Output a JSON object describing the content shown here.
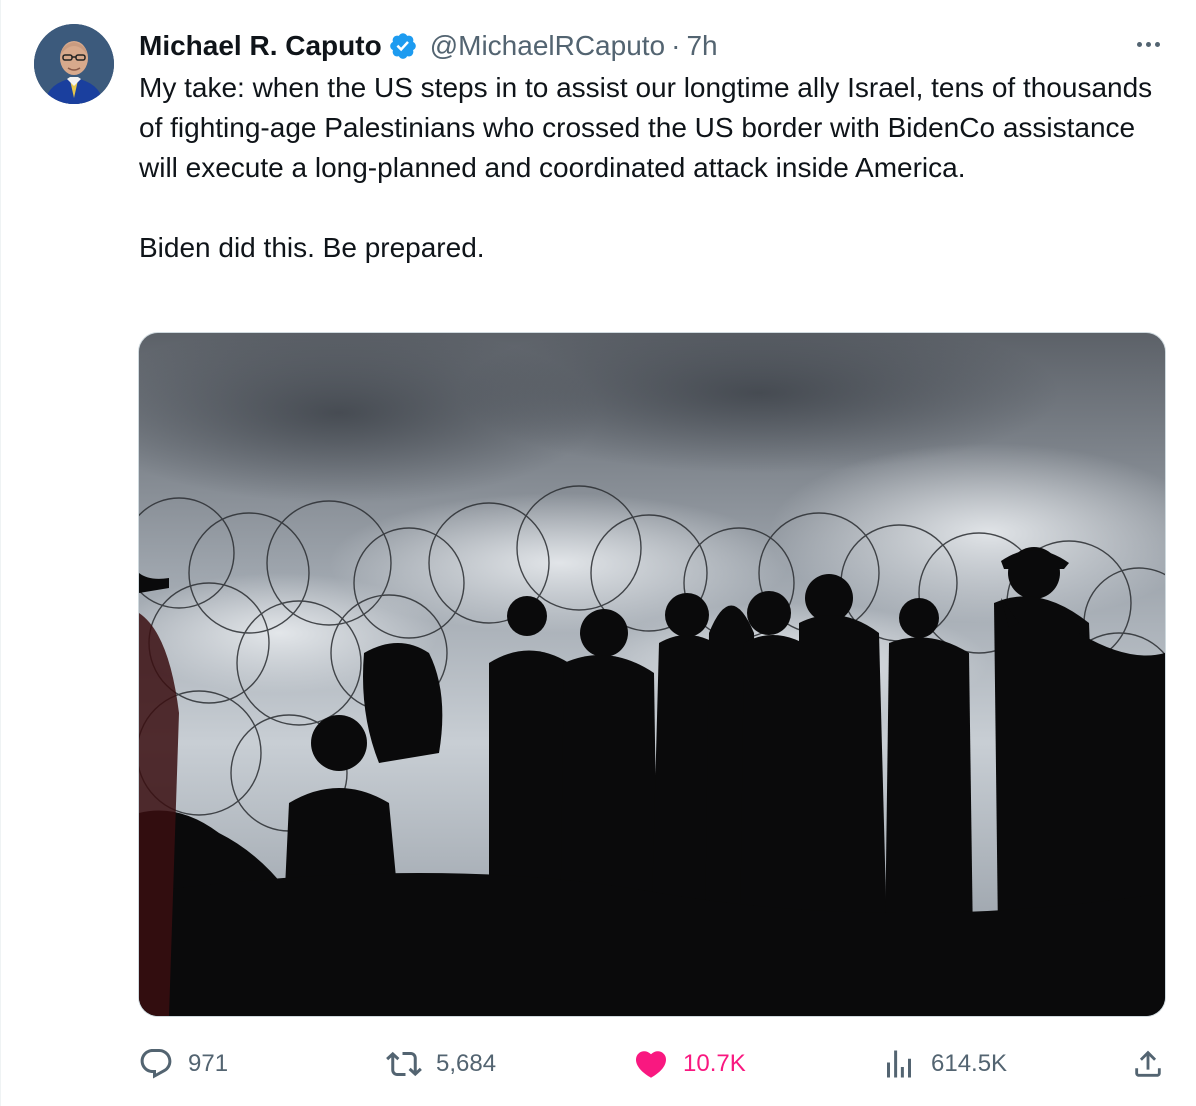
{
  "author": {
    "name": "Michael R. Caputo",
    "handle": "@MichaelRCaputo",
    "separator": "·",
    "time": "7h",
    "verified_color": "#1d9bf0"
  },
  "tweet": {
    "text": "My take: when the US steps in to assist our longtime ally Israel, tens of thousands of fighting-age Palestinians who crossed the US border with BidenCo assistance will execute a long-planned and coordinated attack inside America.\n\nBiden did this. Be prepared."
  },
  "media": {
    "icon": "photo-silhouettes-razor-wire"
  },
  "actions": {
    "reply_count": "971",
    "retweet_count": "5,684",
    "like_count": "10.7K",
    "views_count": "614.5K",
    "like_color": "#f91880",
    "icons": [
      "reply-icon",
      "retweet-icon",
      "heart-icon",
      "views-icon",
      "share-icon"
    ]
  },
  "colors": {
    "text_primary": "#0f1419",
    "text_secondary": "#536471",
    "border": "#cfd9de"
  }
}
